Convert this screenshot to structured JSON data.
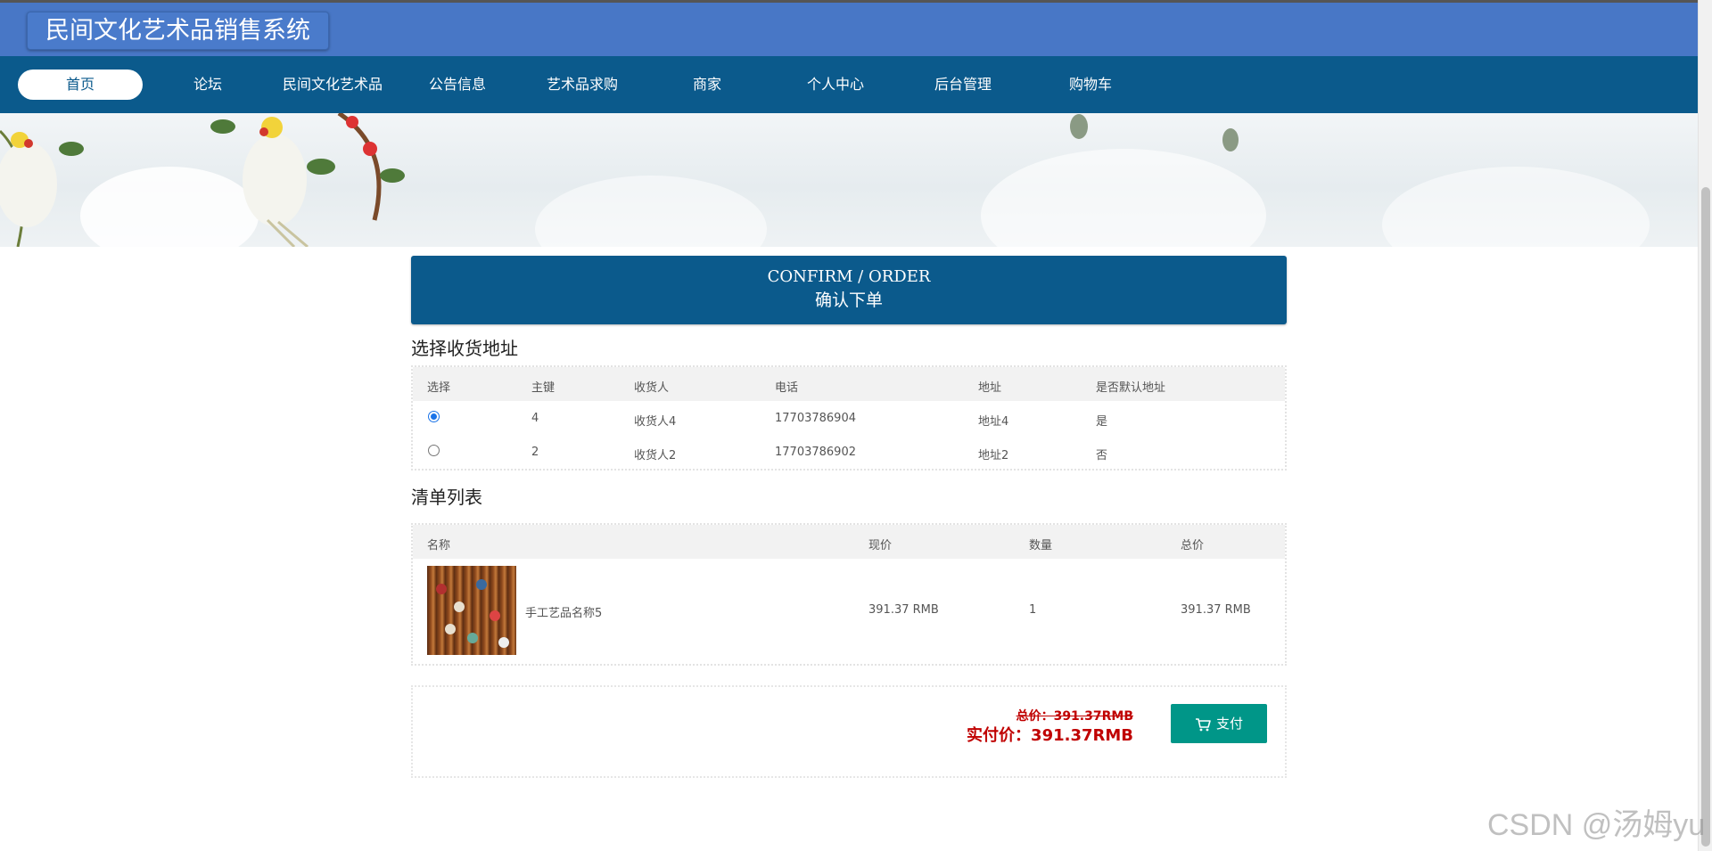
{
  "header": {
    "site_title": "民间文化艺术品销售系统"
  },
  "nav": {
    "items": [
      {
        "label": "首页",
        "active": true
      },
      {
        "label": "论坛"
      },
      {
        "label": "民间文化艺术品"
      },
      {
        "label": "公告信息"
      },
      {
        "label": "艺术品求购"
      },
      {
        "label": "商家"
      },
      {
        "label": "个人中心"
      },
      {
        "label": "后台管理"
      },
      {
        "label": "购物车"
      }
    ]
  },
  "confirm": {
    "title_en": "CONFIRM / ORDER",
    "title_cn": "确认下单"
  },
  "address": {
    "section_title": "选择收货地址",
    "headers": {
      "select": "选择",
      "id": "主键",
      "receiver": "收货人",
      "phone": "电话",
      "address": "地址",
      "default": "是否默认地址"
    },
    "rows": [
      {
        "selected": true,
        "id": "4",
        "receiver": "收货人4",
        "phone": "17703786904",
        "address": "地址4",
        "default": "是"
      },
      {
        "selected": false,
        "id": "2",
        "receiver": "收货人2",
        "phone": "17703786902",
        "address": "地址2",
        "default": "否"
      }
    ]
  },
  "cart": {
    "section_title": "清单列表",
    "headers": {
      "name": "名称",
      "price": "现价",
      "qty": "数量",
      "total": "总价"
    },
    "items": [
      {
        "name": "手工艺品名称5",
        "price": "391.37 RMB",
        "qty": "1",
        "total": "391.37 RMB"
      }
    ]
  },
  "summary": {
    "total": "总价：391.37RMB",
    "paid": "实付价：391.37RMB",
    "pay_label": "支付"
  },
  "watermark": "CSDN @汤姆yu",
  "colors": {
    "header": "#4877c6",
    "nav": "#0b5a8c",
    "pay": "#009688",
    "price": "#c00000"
  }
}
